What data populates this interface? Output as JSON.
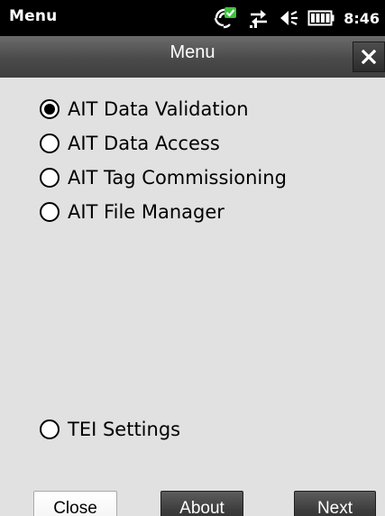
{
  "status_bar": {
    "title": "Menu",
    "time": "8:46",
    "icons": [
      "wireless-sync-icon",
      "data-connection-icon",
      "volume-off-icon",
      "battery-icon"
    ]
  },
  "title_bar": {
    "title": "Menu",
    "close_glyph": "✕"
  },
  "menu": {
    "options": [
      {
        "label": "AIT Data Validation",
        "selected": true
      },
      {
        "label": "AIT Data Access",
        "selected": false
      },
      {
        "label": "AIT Tag Commissioning",
        "selected": false
      },
      {
        "label": "AIT File Manager",
        "selected": false
      }
    ],
    "settings_option": {
      "label": "TEI Settings",
      "selected": false
    }
  },
  "buttons": {
    "close": "Close",
    "about": "About",
    "next": "Next"
  },
  "colors": {
    "status_bar_bg": "#000000",
    "title_bar_bg": "#4a4a4a",
    "content_bg": "#e1e1e1",
    "dark_button_bg": "#3c3c3c",
    "light_button_bg": "#ffffff",
    "sync_check_accent": "#3cc43c"
  }
}
